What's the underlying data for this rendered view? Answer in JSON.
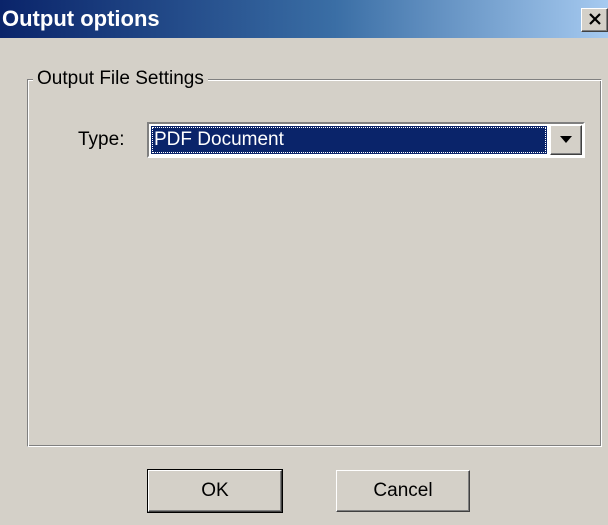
{
  "window": {
    "title": "Output options",
    "close_symbol": "✕",
    "close_icon": "close-icon",
    "title_bar_colors": [
      "#0a246a",
      "#a6caf0"
    ]
  },
  "output_file_settings": {
    "group_label": "Output File Settings",
    "type_label": "Type:",
    "type_selected": "PDF Document",
    "dropdown_icon": "chevron-down-icon"
  },
  "buttons": {
    "ok": "OK",
    "cancel": "Cancel"
  }
}
